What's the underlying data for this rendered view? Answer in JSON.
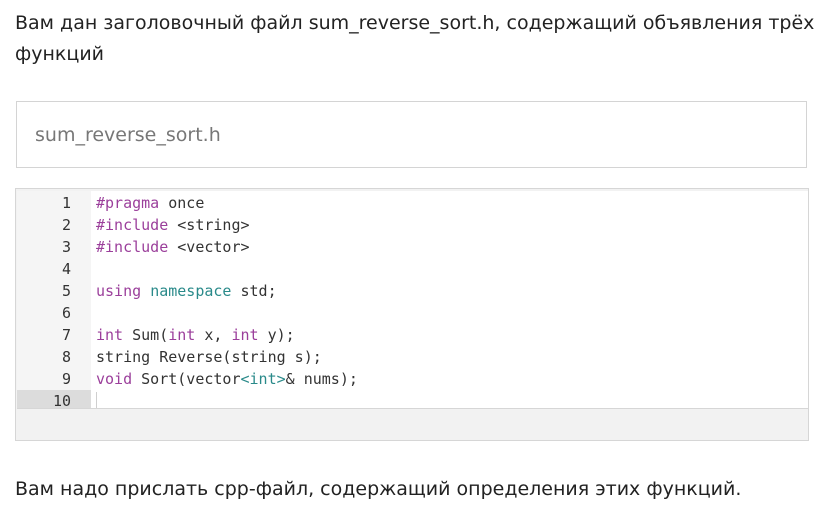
{
  "intro_text": "Вам дан заголовочный файл sum_reverse_sort.h, содержащий объявления трёх функций",
  "file": {
    "name": "sum_reverse_sort.h"
  },
  "code": {
    "lines": [
      {
        "num": "1",
        "tokens": [
          {
            "t": "#pragma",
            "c": "kw"
          },
          {
            "t": " once",
            "c": ""
          }
        ]
      },
      {
        "num": "2",
        "tokens": [
          {
            "t": "#include",
            "c": "kw"
          },
          {
            "t": " <string>",
            "c": ""
          }
        ]
      },
      {
        "num": "3",
        "tokens": [
          {
            "t": "#include",
            "c": "kw"
          },
          {
            "t": " <vector>",
            "c": ""
          }
        ]
      },
      {
        "num": "4",
        "tokens": []
      },
      {
        "num": "5",
        "tokens": [
          {
            "t": "using",
            "c": "kw"
          },
          {
            "t": " ",
            "c": ""
          },
          {
            "t": "namespace",
            "c": "kw2"
          },
          {
            "t": " std;",
            "c": ""
          }
        ]
      },
      {
        "num": "6",
        "tokens": []
      },
      {
        "num": "7",
        "tokens": [
          {
            "t": "int",
            "c": "kw"
          },
          {
            "t": " Sum(",
            "c": ""
          },
          {
            "t": "int",
            "c": "kw"
          },
          {
            "t": " x, ",
            "c": ""
          },
          {
            "t": "int",
            "c": "kw"
          },
          {
            "t": " y);",
            "c": ""
          }
        ]
      },
      {
        "num": "8",
        "tokens": [
          {
            "t": "string Reverse(string s);",
            "c": ""
          }
        ]
      },
      {
        "num": "9",
        "tokens": [
          {
            "t": "void",
            "c": "kw"
          },
          {
            "t": " Sort(vector",
            "c": ""
          },
          {
            "t": "<int>",
            "c": "kw2"
          },
          {
            "t": "& nums);",
            "c": ""
          }
        ]
      },
      {
        "num": "10",
        "tokens": [],
        "active": true
      }
    ]
  },
  "outro_text": "Вам надо прислать cpp-файл, содержащий определения этих функций."
}
